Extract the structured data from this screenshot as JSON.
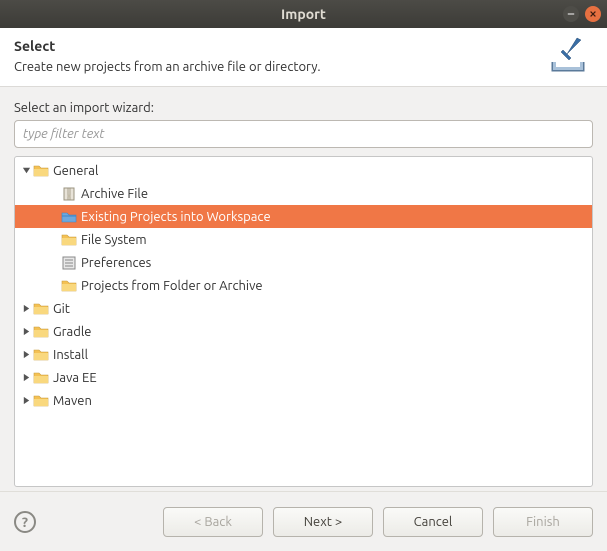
{
  "window": {
    "title": "Import"
  },
  "header": {
    "title": "Select",
    "subtitle": "Create new projects from an archive file or directory."
  },
  "content": {
    "field_label": "Select an import wizard:",
    "filter_placeholder": "type filter text"
  },
  "tree": {
    "categories": [
      {
        "label": "General",
        "expanded": true,
        "children": [
          {
            "label": "Archive File",
            "icon": "archive",
            "selected": false
          },
          {
            "label": "Existing Projects into Workspace",
            "icon": "projects",
            "selected": true
          },
          {
            "label": "File System",
            "icon": "folder",
            "selected": false
          },
          {
            "label": "Preferences",
            "icon": "prefs",
            "selected": false
          },
          {
            "label": "Projects from Folder or Archive",
            "icon": "folder",
            "selected": false
          }
        ]
      },
      {
        "label": "Git",
        "expanded": false
      },
      {
        "label": "Gradle",
        "expanded": false
      },
      {
        "label": "Install",
        "expanded": false
      },
      {
        "label": "Java EE",
        "expanded": false
      },
      {
        "label": "Maven",
        "expanded": false
      }
    ]
  },
  "footer": {
    "back": "< Back",
    "next": "Next >",
    "cancel": "Cancel",
    "finish": "Finish"
  }
}
